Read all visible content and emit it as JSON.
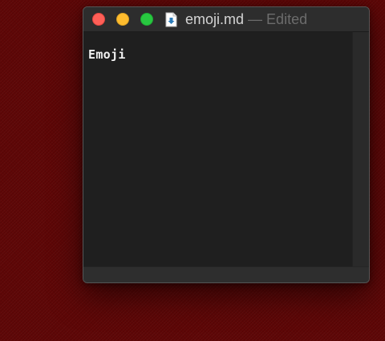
{
  "window": {
    "filename": "emoji.md",
    "separator": " — ",
    "status": "Edited",
    "icons": {
      "close": "close-icon",
      "minimize": "minimize-icon",
      "zoom": "zoom-icon",
      "document": "markdown-document-icon"
    }
  },
  "editor": {
    "content": "Emoji"
  },
  "colors": {
    "desktop": "#5e0606",
    "close": "#fe5f57",
    "minimize": "#febc2e",
    "zoom": "#28c840",
    "editor_bg": "#1f1f1f"
  }
}
